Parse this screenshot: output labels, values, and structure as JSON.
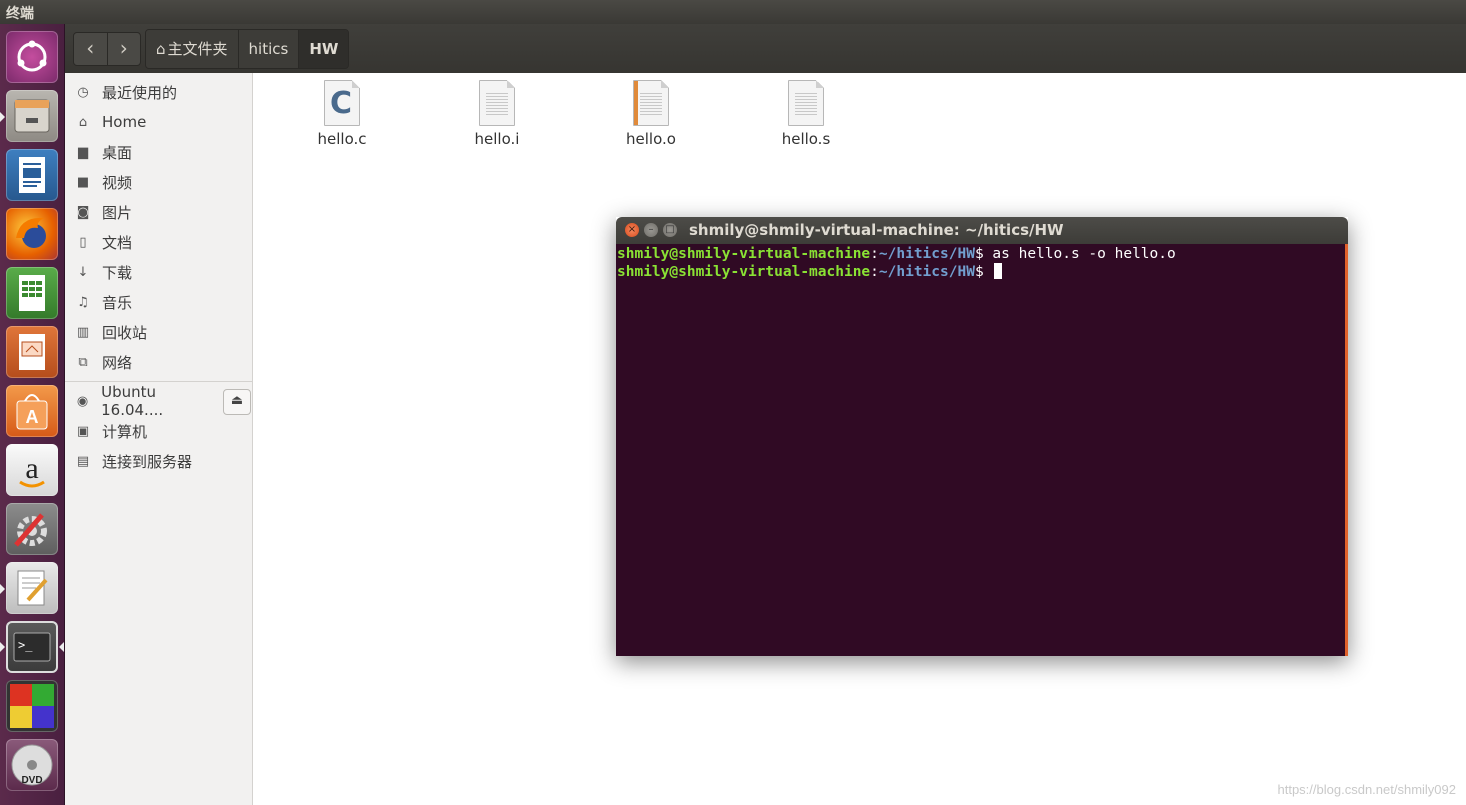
{
  "top_panel": {
    "title": "终端"
  },
  "launcher": {
    "items": [
      {
        "name": "ubuntu-dash"
      },
      {
        "name": "files"
      },
      {
        "name": "libreoffice-writer"
      },
      {
        "name": "firefox"
      },
      {
        "name": "libreoffice-calc"
      },
      {
        "name": "libreoffice-impress"
      },
      {
        "name": "software-center"
      },
      {
        "name": "amazon"
      },
      {
        "name": "system-settings"
      },
      {
        "name": "text-editor"
      },
      {
        "name": "terminal"
      },
      {
        "name": "workspace-switcher"
      },
      {
        "name": "dvd"
      }
    ]
  },
  "file_manager": {
    "nav": {
      "back": "‹",
      "forward": "›"
    },
    "breadcrumb": [
      "主文件夹",
      "hitics",
      "HW"
    ],
    "sidebar": {
      "places": [
        "最近使用的",
        "Home",
        "桌面",
        "视频",
        "图片",
        "文档",
        "下载",
        "音乐",
        "回收站",
        "网络"
      ],
      "devices": [
        "Ubuntu 16.04....",
        "计算机",
        "连接到服务器"
      ]
    },
    "files": [
      "hello.c",
      "hello.i",
      "hello.o",
      "hello.s"
    ]
  },
  "terminal": {
    "title": "shmily@shmily-virtual-machine: ~/hitics/HW",
    "lines": [
      {
        "user": "shmily@shmily-virtual-machine",
        "path": "~/hitics/HW",
        "cmd": "as hello.s -o hello.o"
      },
      {
        "user": "shmily@shmily-virtual-machine",
        "path": "~/hitics/HW",
        "cmd": ""
      }
    ]
  },
  "watermark": "https://blog.csdn.net/shmily092"
}
